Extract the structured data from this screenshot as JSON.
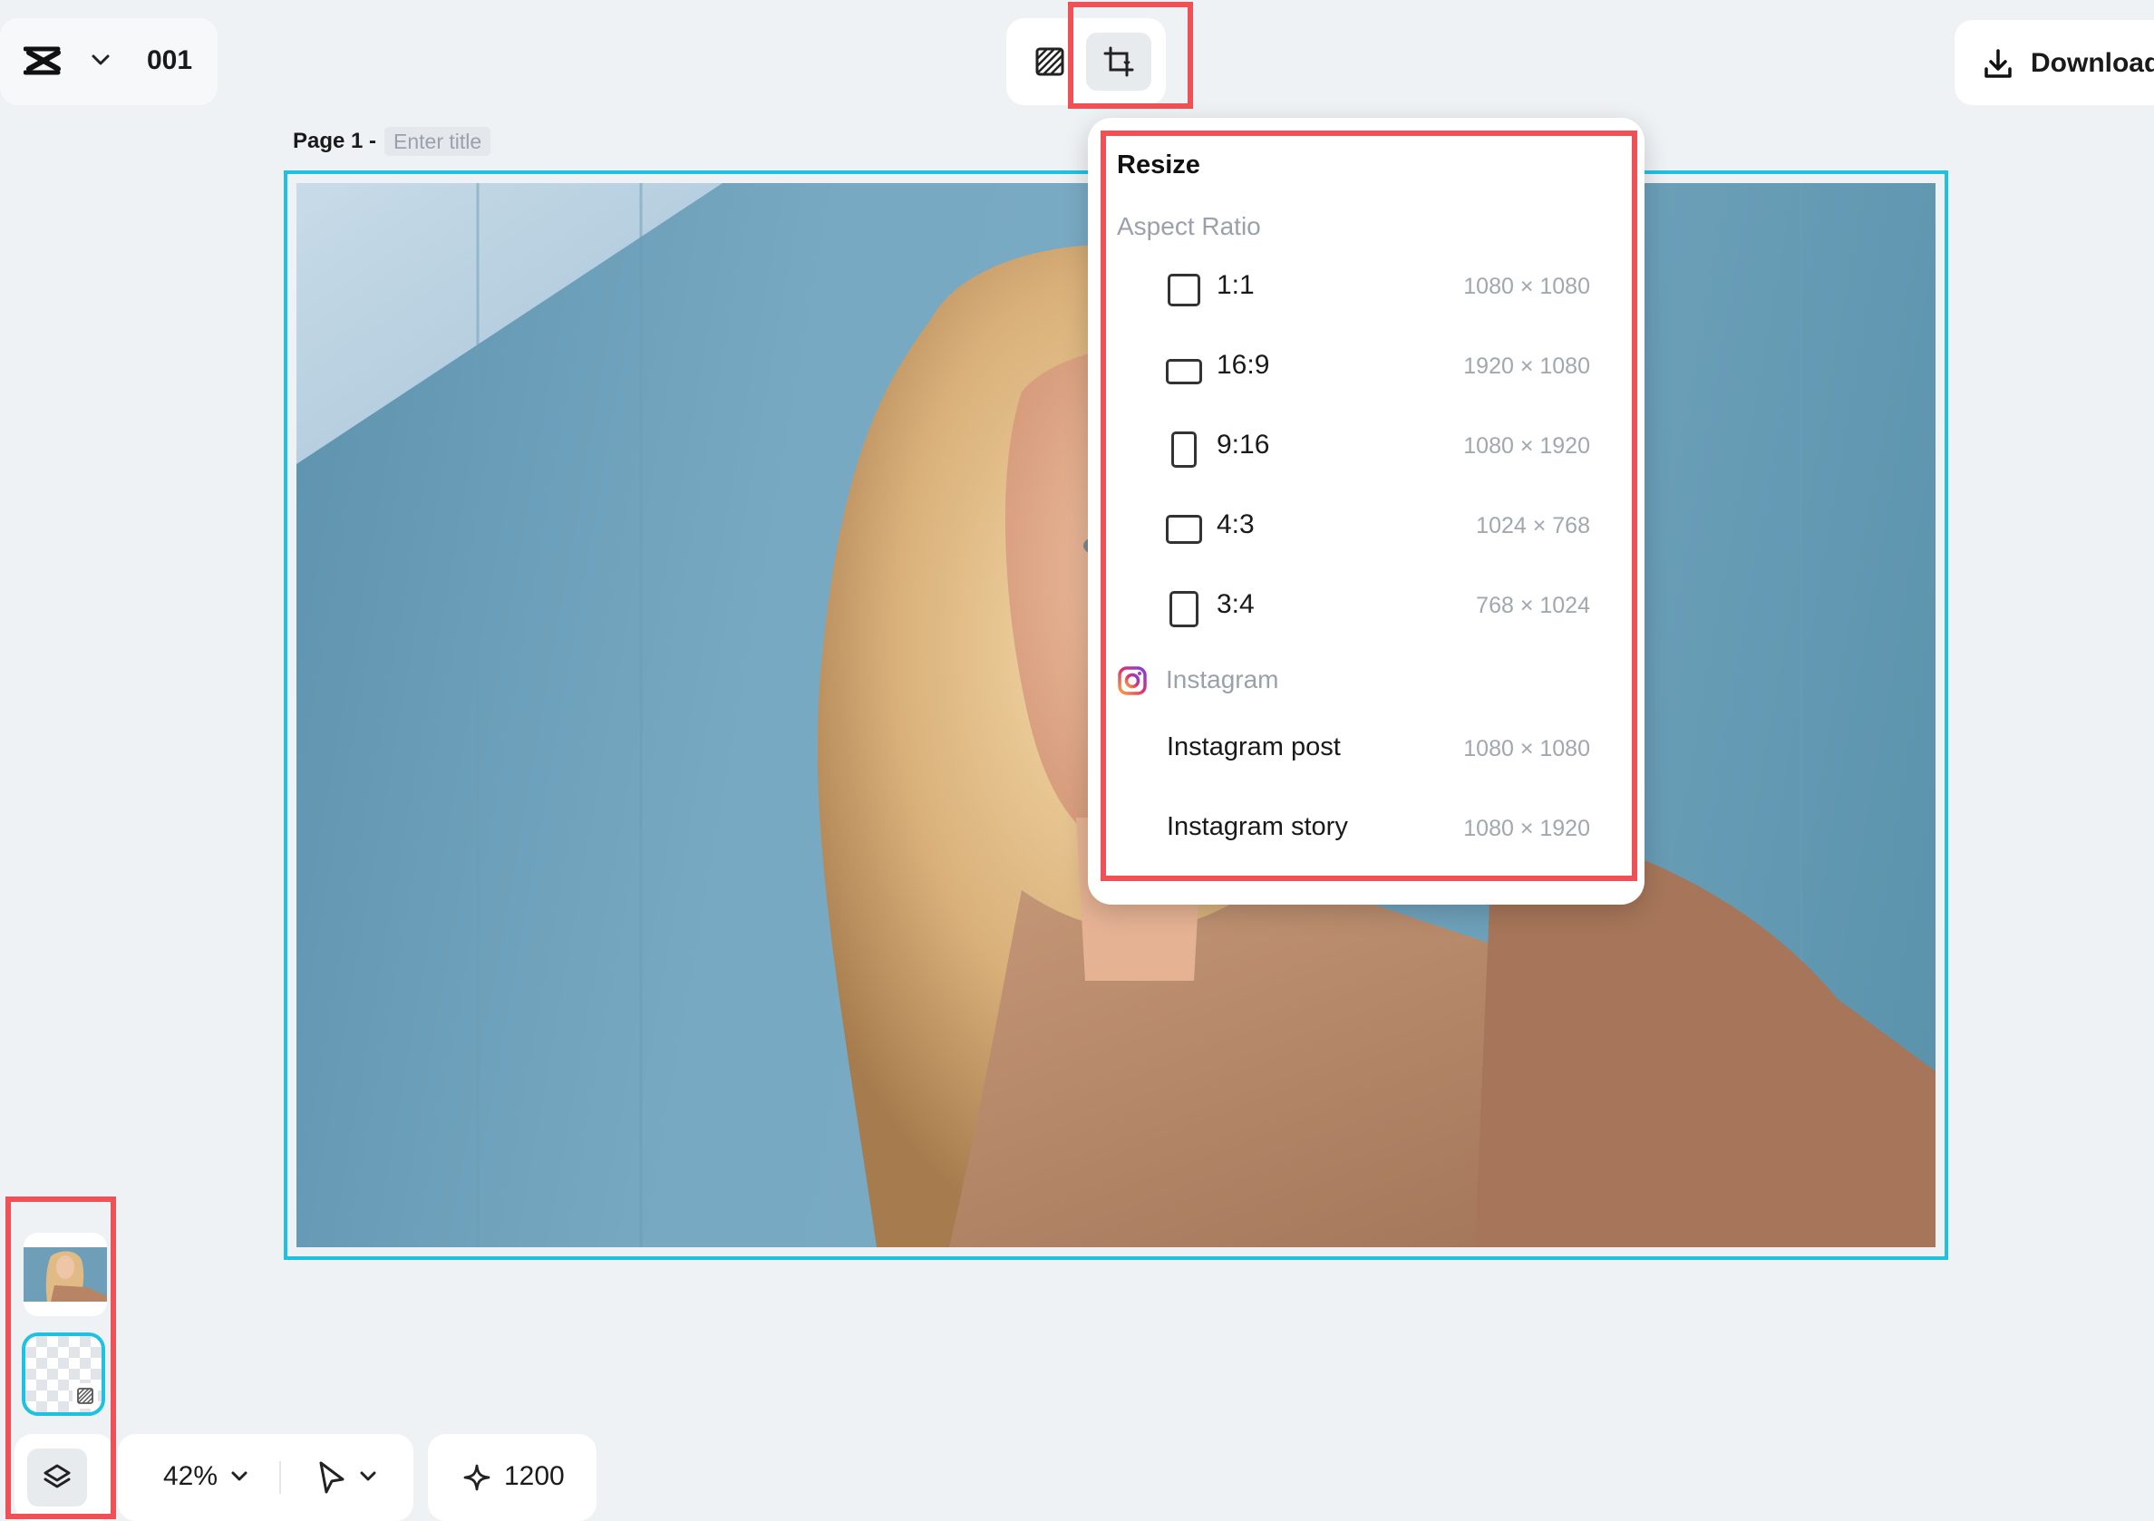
{
  "project": {
    "name": "001",
    "logo_icon": "capcut-logo-icon"
  },
  "toolbar": {
    "bg_icon": "background-pattern-icon",
    "resize_icon": "resize-icon"
  },
  "download": {
    "label": "Download"
  },
  "page": {
    "label": "Page 1 -",
    "title_placeholder": "Enter title"
  },
  "resize_menu": {
    "title": "Resize",
    "aspect_section": "Aspect Ratio",
    "aspect_options": [
      {
        "label": "1:1",
        "size": "1080 × 1080"
      },
      {
        "label": "16:9",
        "size": "1920 × 1080"
      },
      {
        "label": "9:16",
        "size": "1080 × 1920"
      },
      {
        "label": "4:3",
        "size": "1024 × 768"
      },
      {
        "label": "3:4",
        "size": "768 × 1024"
      }
    ],
    "instagram_section": "Instagram",
    "instagram_options": [
      {
        "label": "Instagram post",
        "size": "1080 × 1080"
      },
      {
        "label": "Instagram story",
        "size": "1080 × 1920"
      }
    ]
  },
  "bottom": {
    "zoom": "42%",
    "credits": "1200"
  },
  "colors": {
    "accent": "#1fc1e3",
    "highlight": "#ef5156"
  }
}
